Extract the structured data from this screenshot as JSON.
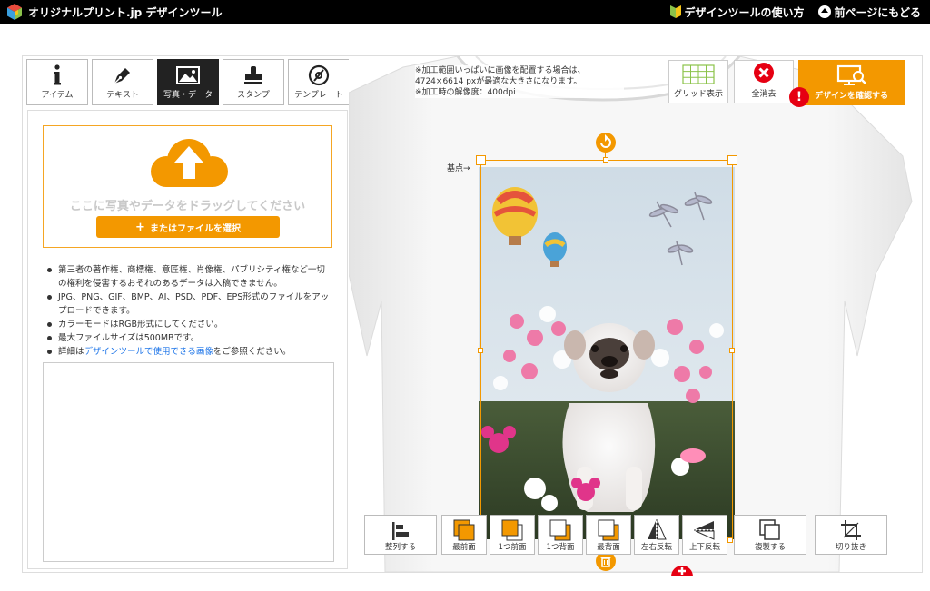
{
  "header": {
    "logo_text": "オリジナルプリント.jp デザインツール",
    "links": [
      {
        "label": "デザインツールの使い方",
        "icon": "beginner-mark-icon"
      },
      {
        "label": "前ページにもどる",
        "icon": "back-arrow-icon"
      }
    ]
  },
  "tabs": [
    {
      "label": "アイテム",
      "icon": "info-icon"
    },
    {
      "label": "テキスト",
      "icon": "pen-icon"
    },
    {
      "label": "写真・データ",
      "icon": "image-icon",
      "active": true
    },
    {
      "label": "スタンプ",
      "icon": "stamp-icon"
    },
    {
      "label": "テンプレート",
      "icon": "template-icon"
    }
  ],
  "upload": {
    "drop_text": "ここに写真やデータをドラッグしてください",
    "file_button": "またはファイルを選択"
  },
  "notes": {
    "n1": "第三者の著作権、商標権、意匠権、肖像権、パブリシティ権など一切の権利を侵害するおそれのあるデータは入稿できません。",
    "n2": "JPG、PNG、GIF、BMP、AI、PSD、PDF、EPS形式のファイルをアップロードできます。",
    "n3": "カラーモードはRGB形式にしてください。",
    "n4": "最大ファイルサイズは500MBです。",
    "n5_prefix": "詳細は",
    "n5_link": "デザインツールで使用できる画像",
    "n5_suffix": "をご参照ください。"
  },
  "canvas": {
    "info_line1": "※加工範囲いっぱいに画像を配置する場合は、",
    "info_line2": "4724×6614 pxが最適な大きさになります。",
    "info_line3": "※加工時の解像度：400dpi",
    "basepoint_label": "基点→"
  },
  "top_tools": {
    "grid": "グリッド表示",
    "clear": "全消去",
    "confirm": "デザインを確認する"
  },
  "bottom_tools": [
    {
      "label": "整列する",
      "icon": "align-icon"
    },
    {
      "label": "最前面",
      "icon": "bring-front-icon"
    },
    {
      "label": "1つ前面",
      "icon": "bring-forward-icon"
    },
    {
      "label": "1つ背面",
      "icon": "send-backward-icon"
    },
    {
      "label": "最背面",
      "icon": "send-back-icon"
    },
    {
      "label": "左右反転",
      "icon": "flip-horizontal-icon"
    },
    {
      "label": "上下反転",
      "icon": "flip-vertical-icon"
    },
    {
      "label": "複製する",
      "icon": "duplicate-icon"
    },
    {
      "label": "切り抜き",
      "icon": "crop-icon"
    }
  ],
  "colors": {
    "accent": "#f39800",
    "alert": "#e60012",
    "header_bg": "#000000",
    "link": "#1a73e8"
  }
}
